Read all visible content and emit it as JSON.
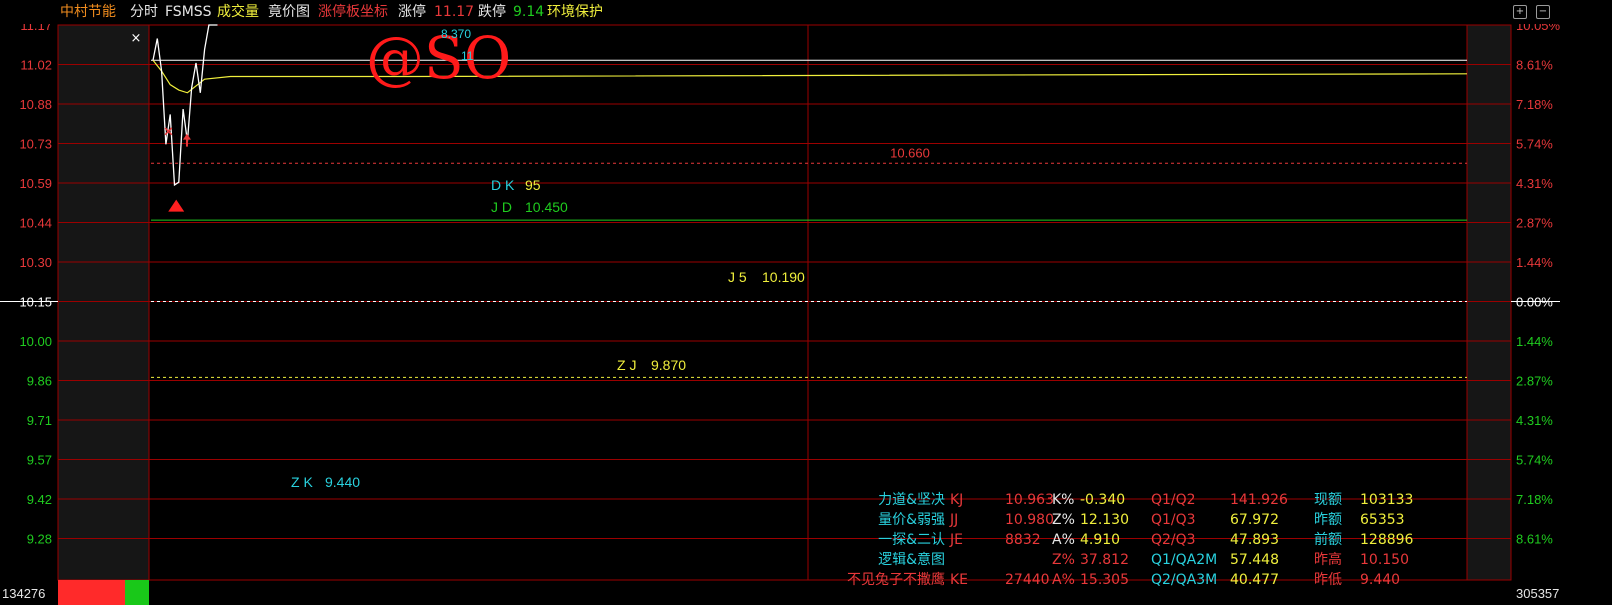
{
  "header": {
    "stock_name": "中村节能",
    "mode": "分时",
    "indicator": "FSMSS",
    "volume_label": "成交量",
    "auction_label": "竟价图",
    "limit_coord_label": "涨停板坐标",
    "limit_up_label": "涨停",
    "limit_up_value": "11.17",
    "limit_down_label": "跌停",
    "limit_down_value": "9.14",
    "env_label": "环境保护"
  },
  "colors": {
    "background": "#000000",
    "grid": "#9b0000",
    "price_up": "#e8383a",
    "price_down": "#1fcc1f",
    "cyan": "#29d1de",
    "yellow": "#f0ef3c"
  },
  "watermark": "@SO",
  "cross_marker": "×",
  "chart_data": {
    "type": "line",
    "title": "",
    "prev_close": 10.15,
    "ylim": [
      9.14,
      11.17
    ],
    "left_ticks": [
      "11.17",
      "11.02",
      "10.88",
      "10.73",
      "10.59",
      "10.44",
      "10.30",
      "10.15",
      "10.00",
      "9.86",
      "9.71",
      "9.57",
      "9.42",
      "9.28"
    ],
    "right_ticks": [
      "10.05%",
      "8.61%",
      "7.18%",
      "5.74%",
      "4.31%",
      "2.87%",
      "1.44%",
      "0.00%",
      "1.44%",
      "2.87%",
      "4.31%",
      "5.74%",
      "7.18%",
      "8.61%"
    ],
    "left_bottom_label": "134276",
    "right_bottom_label": "305357",
    "price_series": {
      "name": "",
      "x": [
        0,
        1,
        2,
        3,
        4,
        5,
        6,
        7,
        8,
        9,
        10,
        11,
        12,
        13,
        14,
        15
      ],
      "values": [
        11.04,
        11.12,
        11.0,
        10.73,
        10.84,
        10.58,
        10.59,
        10.86,
        10.74,
        10.94,
        11.03,
        10.92,
        11.08,
        11.17,
        11.17,
        11.17
      ]
    },
    "avg_series": {
      "name": "",
      "x": [
        0,
        2,
        4,
        6,
        8,
        12,
        18,
        60,
        240
      ],
      "values": [
        11.04,
        11.0,
        10.95,
        10.93,
        10.92,
        10.97,
        10.98,
        10.98,
        10.99
      ]
    },
    "level_lines": [
      {
        "label": "",
        "value": 11.04,
        "color": "#ffffff",
        "style": "solid"
      },
      {
        "label": "10.660",
        "value": 10.66,
        "color": "#e8383a",
        "style": "dashed"
      },
      {
        "label": "",
        "value": 10.45,
        "color": "#1fcc1f",
        "style": "solid"
      },
      {
        "label": "",
        "value": 10.15,
        "color": "#ffffff",
        "style": "dashed"
      },
      {
        "label": "",
        "value": 9.87,
        "color": "#f0ef3c",
        "style": "dashed"
      }
    ],
    "text_labels": [
      {
        "key": "DK",
        "text": "D K",
        "value": "95",
        "color": "#29d1de",
        "vcolor": "#f0ef3c"
      },
      {
        "key": "JD",
        "text": "J D",
        "value": "10.450",
        "color": "#1fcc1f",
        "vcolor": "#1fcc1f"
      },
      {
        "key": "J5",
        "text": "J 5",
        "value": "10.190",
        "color": "#f0ef3c",
        "vcolor": "#f0ef3c"
      },
      {
        "key": "ZJ",
        "text": "Z J",
        "value": "9.870",
        "color": "#f0ef3c",
        "vcolor": "#f0ef3c"
      },
      {
        "key": "ZK",
        "text": "Z K",
        "value": "9.440",
        "color": "#29d1de",
        "vcolor": "#29d1de"
      }
    ],
    "top_readout": [
      "8.370",
      "11"
    ]
  },
  "info_panel": [
    {
      "label": "力道&坚决",
      "k1": "KJ",
      "v1": "10.963",
      "k2": "K%",
      "v2": "-0.340",
      "k3": "Q1/Q2",
      "v3": "141.926",
      "k4": "现额",
      "v4": "103133"
    },
    {
      "label": "量价&弱强",
      "k1": "JJ",
      "v1": "10.980",
      "k2": "Z%",
      "v2": "12.130",
      "k3": "Q1/Q3",
      "v3": "67.972",
      "k4": "昨额",
      "v4": "65353"
    },
    {
      "label": "一探&二认",
      "k1": "JE",
      "v1": "8832",
      "k2": "A%",
      "v2": "4.910",
      "k3": "Q2/Q3",
      "v3": "47.893",
      "k4": "前额",
      "v4": "128896"
    },
    {
      "label": "逻辑&意图",
      "k1": "",
      "v1": "",
      "k2": "Z%",
      "v2": "37.812",
      "k3": "Q1/QA2M",
      "v3": "57.448",
      "k4": "昨高",
      "v4": "10.150"
    },
    {
      "label": "不见兔子不撒鹰",
      "k1": "KE",
      "v1": "27440",
      "k2": "A%",
      "v2": "15.305",
      "k3": "Q2/QA3M",
      "v3": "40.477",
      "k4": "昨低",
      "v4": "9.440"
    }
  ]
}
